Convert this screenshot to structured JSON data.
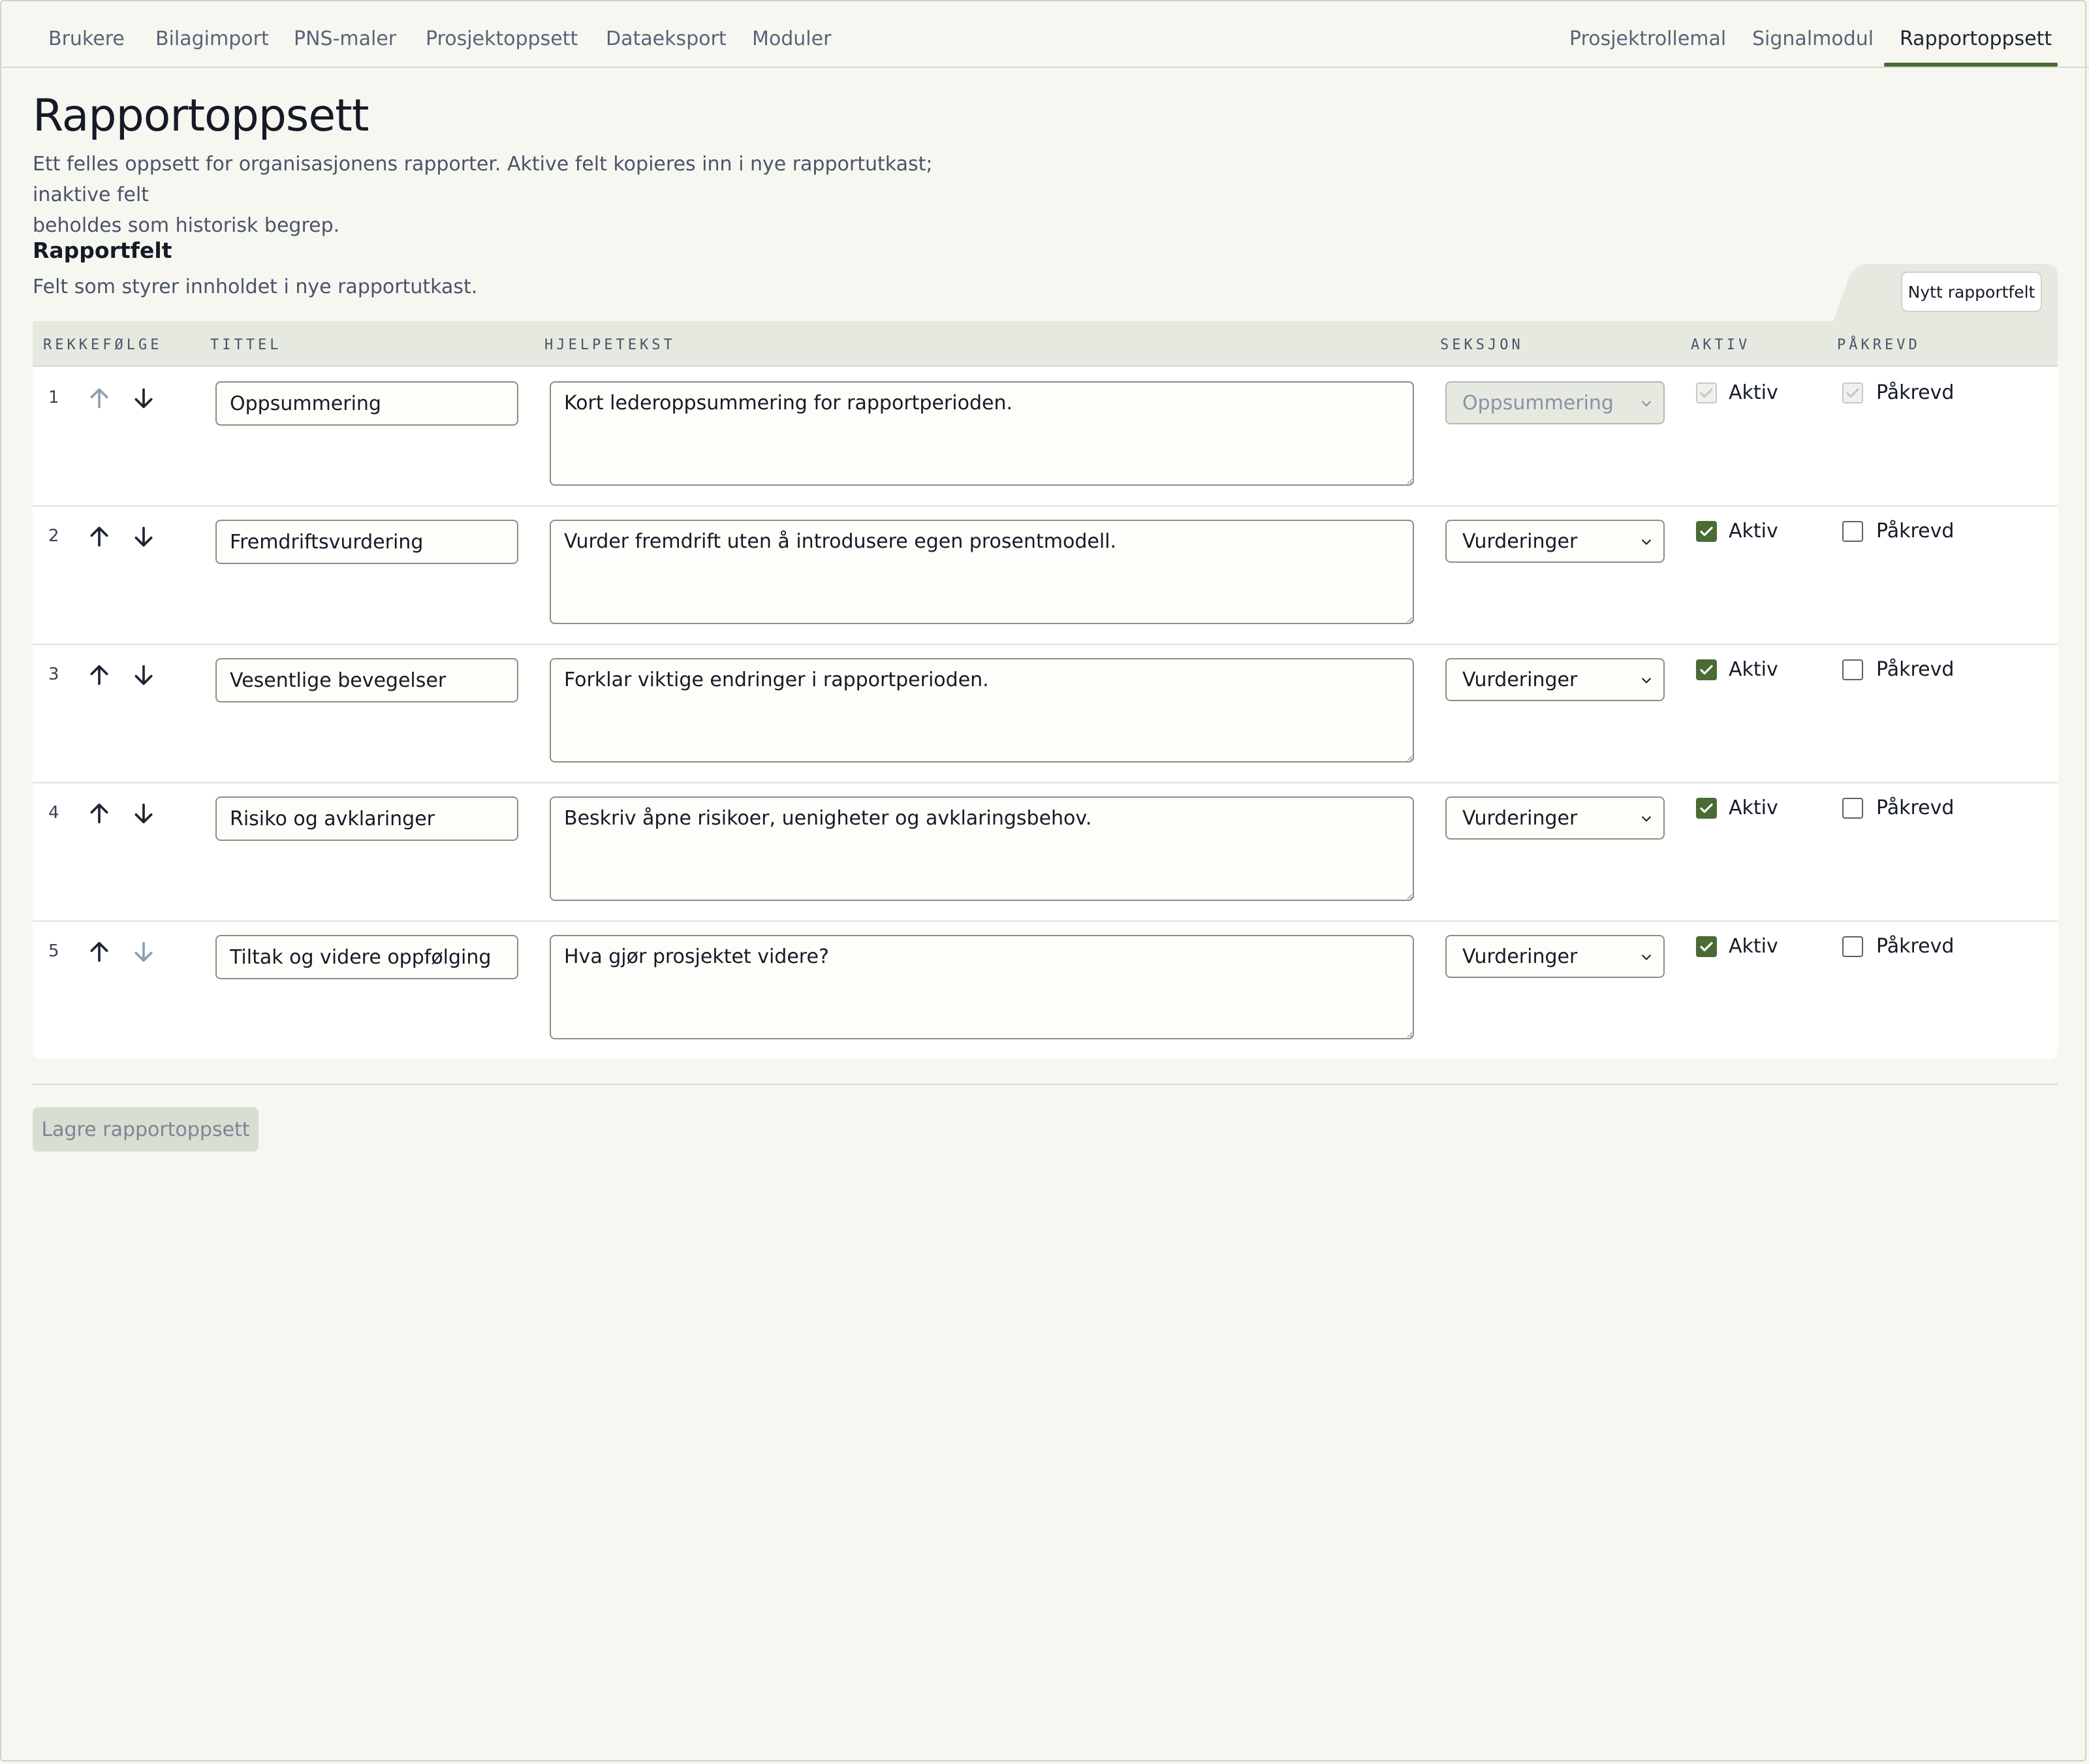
{
  "nav": {
    "left": [
      "Brukere",
      "Bilagimport",
      "PNS-maler",
      "Prosjektoppsett",
      "Dataeksport",
      "Moduler"
    ],
    "right": [
      "Prosjektrollemal",
      "Signalmodul",
      "Rapportoppsett"
    ],
    "active": "Rapportoppsett"
  },
  "page": {
    "title": "Rapportoppsett",
    "description_line1": "Ett felles oppsett for organisasjonens rapporter. Aktive felt kopieres inn i nye rapportutkast; inaktive felt",
    "description_line2": "beholdes som historisk begrep."
  },
  "section": {
    "title": "Rapportfelt",
    "subtitle": "Felt som styrer innholdet i nye rapportutkast.",
    "new_button": "Nytt rapportfelt"
  },
  "table": {
    "headers": {
      "order": "REKKEFØLGE",
      "title": "TITTEL",
      "help": "HJELPETEKST",
      "section": "SEKSJON",
      "active": "AKTIV",
      "required": "PÅKREVD"
    },
    "active_label": "Aktiv",
    "required_label": "Påkrevd",
    "rows": [
      {
        "num": "1",
        "title": "Oppsummering",
        "help": "Kort lederoppsummering for rapportperioden.",
        "section": "Oppsummering",
        "active": true,
        "required": true,
        "locked": true,
        "up_enabled": false,
        "down_enabled": true
      },
      {
        "num": "2",
        "title": "Fremdriftsvurdering",
        "help": "Vurder fremdrift uten å introdusere egen prosentmodell.",
        "section": "Vurderinger",
        "active": true,
        "required": false,
        "locked": false,
        "up_enabled": true,
        "down_enabled": true
      },
      {
        "num": "3",
        "title": "Vesentlige bevegelser",
        "help": "Forklar viktige endringer i rapportperioden.",
        "section": "Vurderinger",
        "active": true,
        "required": false,
        "locked": false,
        "up_enabled": true,
        "down_enabled": true
      },
      {
        "num": "4",
        "title": "Risiko og avklaringer",
        "help": "Beskriv åpne risikoer, uenigheter og avklaringsbehov.",
        "section": "Vurderinger",
        "active": true,
        "required": false,
        "locked": false,
        "up_enabled": true,
        "down_enabled": true
      },
      {
        "num": "5",
        "title": "Tiltak og videre oppfølging",
        "help": "Hva gjør prosjektet videre?",
        "section": "Vurderinger",
        "active": true,
        "required": false,
        "locked": false,
        "up_enabled": true,
        "down_enabled": false
      }
    ]
  },
  "footer": {
    "save_button": "Lagre rapportoppsett"
  },
  "colors": {
    "accent": "#4a6b34",
    "header_bg": "#e6e9e0",
    "page_bg": "#f7f7f2"
  }
}
